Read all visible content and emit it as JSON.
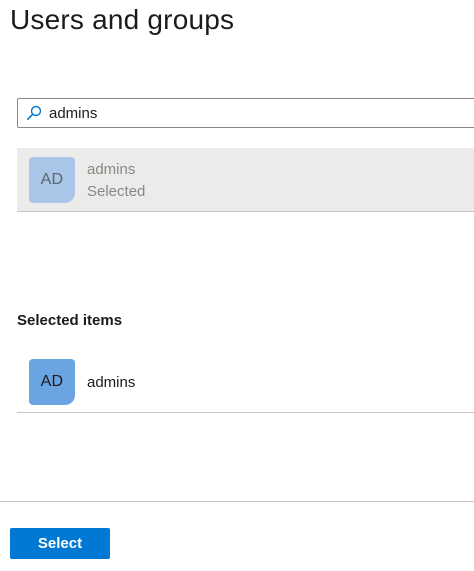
{
  "page": {
    "title": "Users and groups"
  },
  "search": {
    "value": "admins",
    "icon": "search-icon"
  },
  "results": [
    {
      "initials": "AD",
      "name": "admins",
      "status": "Selected",
      "avatar_color": "#a9c6e8"
    }
  ],
  "selected_section": {
    "heading": "Selected items",
    "items": [
      {
        "initials": "AD",
        "name": "admins",
        "avatar_color": "#6aa4e2"
      }
    ]
  },
  "footer": {
    "select_label": "Select"
  },
  "colors": {
    "accent": "#0078d4",
    "row_highlight": "#edebe9",
    "divider": "#c8c6c4"
  }
}
